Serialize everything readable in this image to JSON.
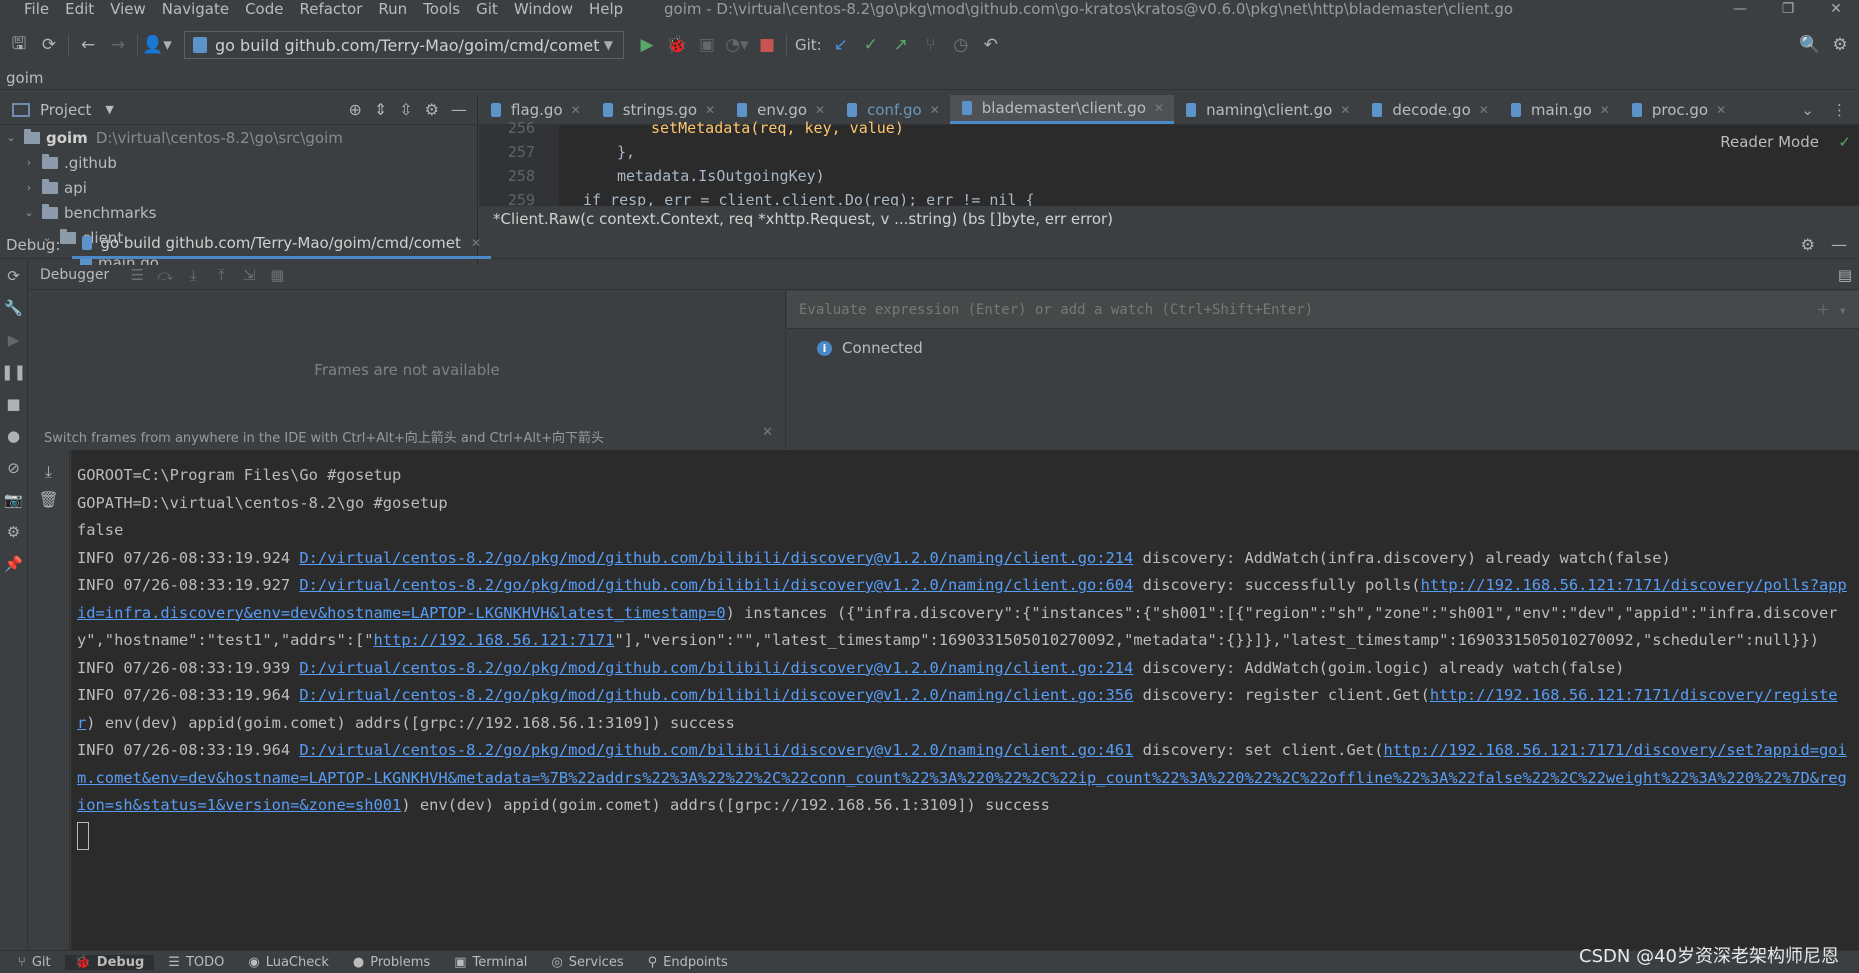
{
  "menu": [
    "File",
    "Edit",
    "View",
    "Navigate",
    "Code",
    "Refactor",
    "Run",
    "Tools",
    "Git",
    "Window",
    "Help"
  ],
  "window_title": "goim - D:\\virtual\\centos-8.2\\go\\pkg\\mod\\github.com\\go-kratos\\kratos@v0.6.0\\pkg\\net\\http\\blademaster\\client.go",
  "toolbar": {
    "run_config": "go build github.com/Terry-Mao/goim/cmd/comet",
    "git_label": "Git:"
  },
  "breadcrumb": "goim",
  "project": {
    "title": "Project",
    "tree": [
      {
        "label": "goim",
        "path": "D:\\virtual\\centos-8.2\\go\\src\\goim"
      },
      {
        "label": ".github"
      },
      {
        "label": "api"
      },
      {
        "label": "benchmarks"
      },
      {
        "label": "client"
      },
      {
        "label": "main.go"
      }
    ]
  },
  "editor": {
    "tabs": [
      "flag.go",
      "strings.go",
      "env.go",
      "conf.go",
      "blademaster\\client.go",
      "naming\\client.go",
      "decode.go",
      "main.go",
      "proc.go"
    ],
    "active_tab": "blademaster\\client.go",
    "reader_mode": "Reader Mode",
    "lines": [
      {
        "num": "256",
        "text": "setMetadata(req, key, value)"
      },
      {
        "num": "257",
        "text": "},"
      },
      {
        "num": "258",
        "text": "metadata.IsOutgoingKey)"
      },
      {
        "num": "259",
        "text": "if resp, err = client.client.Do(req); err != nil {"
      }
    ],
    "hint": "*Client.Raw(c context.Context, req *xhttp.Request, v ...string) (bs []byte, err error)"
  },
  "debug": {
    "label": "Debug:",
    "tab": "go build github.com/Terry-Mao/goim/cmd/comet",
    "debugger_label": "Debugger",
    "frames_empty": "Frames are not available",
    "frames_tip": "Switch frames from anywhere in the IDE with Ctrl+Alt+向上箭头 and Ctrl+Alt+向下箭头",
    "watch_placeholder": "Evaluate expression (Enter) or add a watch (Ctrl+Shift+Enter)",
    "connected": "Connected"
  },
  "console": {
    "lines": [
      {
        "pre": "GOROOT=C:\\Program Files\\Go #gosetup"
      },
      {
        "pre": "GOPATH=D:\\virtual\\centos-8.2\\go #gosetup"
      },
      {
        "pre": "false"
      },
      {
        "pre": "INFO 07/26-08:33:19.924 ",
        "link": "D:/virtual/centos-8.2/go/pkg/mod/github.com/bilibili/discovery@v1.2.0/naming/client.go:214",
        "post": " discovery: AddWatch(infra.discovery) already watch(false)"
      },
      {
        "pre": "INFO 07/26-08:33:19.927 ",
        "link": "D:/virtual/centos-8.2/go/pkg/mod/github.com/bilibili/discovery@v1.2.0/naming/client.go:604",
        "post": " discovery: successfully polls(",
        "link2": "http://192.168.56.121:7171/discovery/polls?appid=infra.discovery&env=dev&hostname=LAPTOP-LKGNKHVH&latest_timestamp=0",
        "post2": ") instances ({\"infra.discovery\":{\"instances\":{\"sh001\":[{\"region\":\"sh\",\"zone\":\"sh001\",\"env\":\"dev\",\"appid\":\"infra.discovery\",\"hostname\":\"test1\",\"addrs\":[\"",
        "link3": "http://192.168.56.121:7171",
        "post3": "\"],\"version\":\"\",\"latest_timestamp\":1690331505010270092,\"metadata\":{}}]},\"latest_timestamp\":1690331505010270092,\"scheduler\":null}})"
      },
      {
        "pre": "INFO 07/26-08:33:19.939 ",
        "link": "D:/virtual/centos-8.2/go/pkg/mod/github.com/bilibili/discovery@v1.2.0/naming/client.go:214",
        "post": " discovery: AddWatch(goim.logic) already watch(false)"
      },
      {
        "pre": "INFO 07/26-08:33:19.964 ",
        "link": "D:/virtual/centos-8.2/go/pkg/mod/github.com/bilibili/discovery@v1.2.0/naming/client.go:356",
        "post": " discovery: register client.Get(",
        "link2": "http://192.168.56.121:7171/discovery/register",
        "post2": ") env(dev) appid(goim.comet) addrs([grpc://192.168.56.1:3109]) success"
      },
      {
        "pre": "INFO 07/26-08:33:19.964 ",
        "link": "D:/virtual/centos-8.2/go/pkg/mod/github.com/bilibili/discovery@v1.2.0/naming/client.go:461",
        "post": " discovery: set client.Get(",
        "link2": "http://192.168.56.121:7171/discovery/set?appid=goim.comet&env=dev&hostname=LAPTOP-LKGNKHVH&metadata=%7B%22addrs%22%3A%22%22%2C%22conn_count%22%3A%220%22%2C%22ip_count%22%3A%220%22%2C%22offline%22%3A%22false%22%2C%22weight%22%3A%220%22%7D&region=sh&status=1&version=&zone=sh001",
        "post2": ") env(dev) appid(goim.comet) addrs([grpc://192.168.56.1:3109]) success"
      }
    ]
  },
  "bottom_bar": [
    "Git",
    "Debug",
    "TODO",
    "LuaCheck",
    "Problems",
    "Terminal",
    "Services",
    "Endpoints"
  ],
  "watermark": "CSDN @40岁资深老架构师尼恩",
  "colors": {
    "accent": "#4a88c7",
    "link": "#589df6",
    "background": "#2b2b2b",
    "panel": "#3c3f41"
  }
}
